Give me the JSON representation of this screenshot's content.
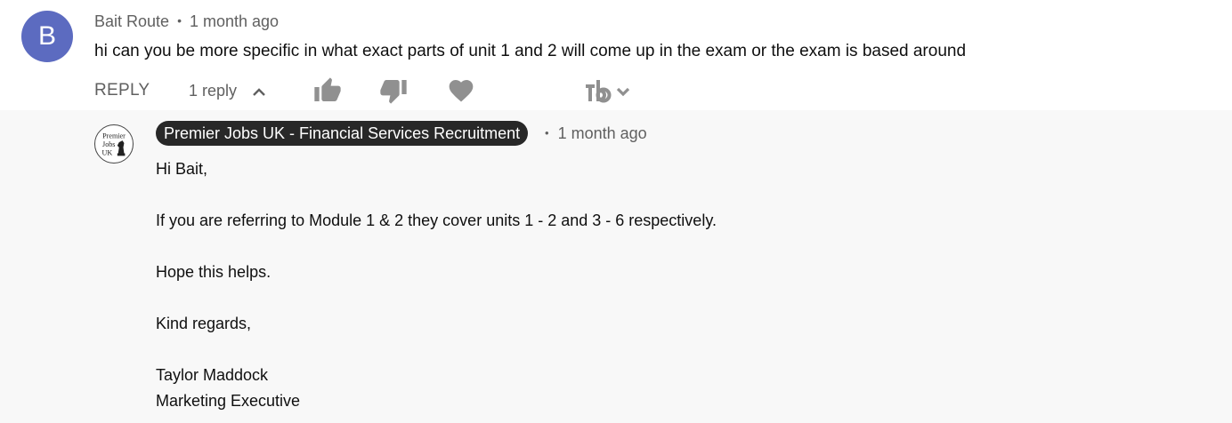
{
  "comment": {
    "avatar_letter": "B",
    "author": "Bait Route",
    "separator": "•",
    "timestamp": "1 month ago",
    "text": "hi can you be more specific in what exact parts of unit 1 and 2 will come up in the exam or the exam is based around",
    "avatar_color": "#5c6bc0"
  },
  "actions": {
    "reply_label": "REPLY",
    "replies_label": "1 reply",
    "replies_icon": "chevron-up-icon",
    "like_icon": "thumbs-up-icon",
    "dislike_icon": "thumbs-down-icon",
    "heart_icon": "heart-icon",
    "extension_icon": "tubebuddy-icon",
    "extension_menu_icon": "chevron-down-icon"
  },
  "reply": {
    "avatar_logo_text": [
      "Premier",
      "Jobs",
      "UK"
    ],
    "author": "Premier Jobs UK - Financial Services Recruitment",
    "separator": "•",
    "timestamp": "1 month ago",
    "lines": [
      "Hi Bait,",
      "",
      "If you are referring to Module 1 & 2 they cover units 1 - 2 and 3 - 6 respectively.",
      "",
      "Hope this helps.",
      "",
      "Kind regards,",
      "",
      "Taylor Maddock",
      "Marketing Executive"
    ]
  },
  "colors": {
    "reply_background": "#f8f8f8",
    "author_chip": "#282828",
    "secondary_text": "#606060",
    "icon": "#909090"
  }
}
